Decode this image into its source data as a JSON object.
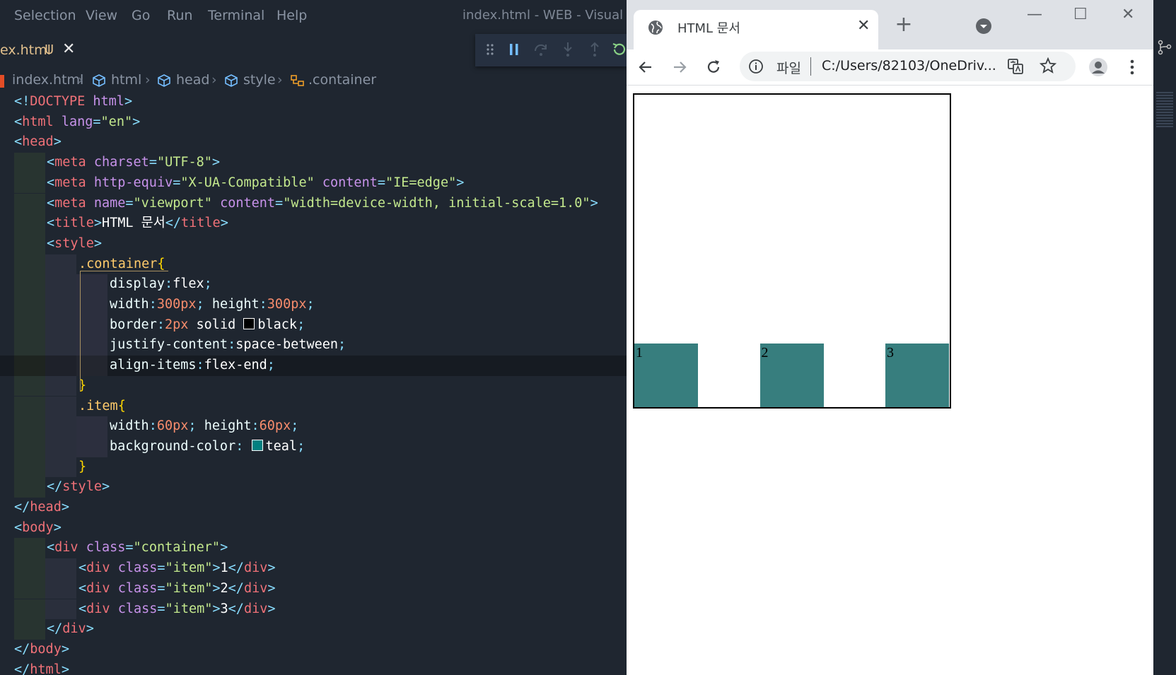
{
  "vscode": {
    "menu": [
      "Selection",
      "View",
      "Go",
      "Run",
      "Terminal",
      "Help"
    ],
    "window_title": "index.html - WEB - Visual Stu",
    "tab": {
      "name": "ex.html",
      "status": "U",
      "close": "✕"
    },
    "breadcrumb": [
      "index.html",
      "html",
      "head",
      "style",
      ".container"
    ],
    "code_lines": [
      "<!DOCTYPE html>",
      "<html lang=\"en\">",
      "<head>",
      "<meta charset=\"UTF-8\">",
      "<meta http-equiv=\"X-UA-Compatible\" content=\"IE=edge\">",
      "<meta name=\"viewport\" content=\"width=device-width, initial-scale=1.0\">",
      "<title>HTML 문서</title>",
      "<style>",
      ".container{",
      "display:flex;",
      "width:300px; height:300px;",
      "border:2px solid black;",
      "justify-content:space-between;",
      "align-items:flex-end;",
      "}",
      ".item{",
      "width:60px; height:60px;",
      "background-color: teal;",
      "}",
      "</style>",
      "</head>",
      "<body>",
      "<div class=\"container\">",
      "<div class=\"item\">1</div>",
      "<div class=\"item\">2</div>",
      "<div class=\"item\">3</div>",
      "</div>",
      "</body>",
      "</html>"
    ]
  },
  "chrome": {
    "tab_title": "HTML 문서",
    "tab_close": "✕",
    "new_tab": "+",
    "omnibox": {
      "scheme_label": "파일",
      "url": "C:/Users/82103/OneDriv..."
    },
    "window_controls": {
      "minimize": "—",
      "maximize": "☐",
      "close": "✕"
    },
    "items": [
      "1",
      "2",
      "3"
    ],
    "colors": {
      "item": "#377e7e",
      "border": "#000000"
    }
  }
}
